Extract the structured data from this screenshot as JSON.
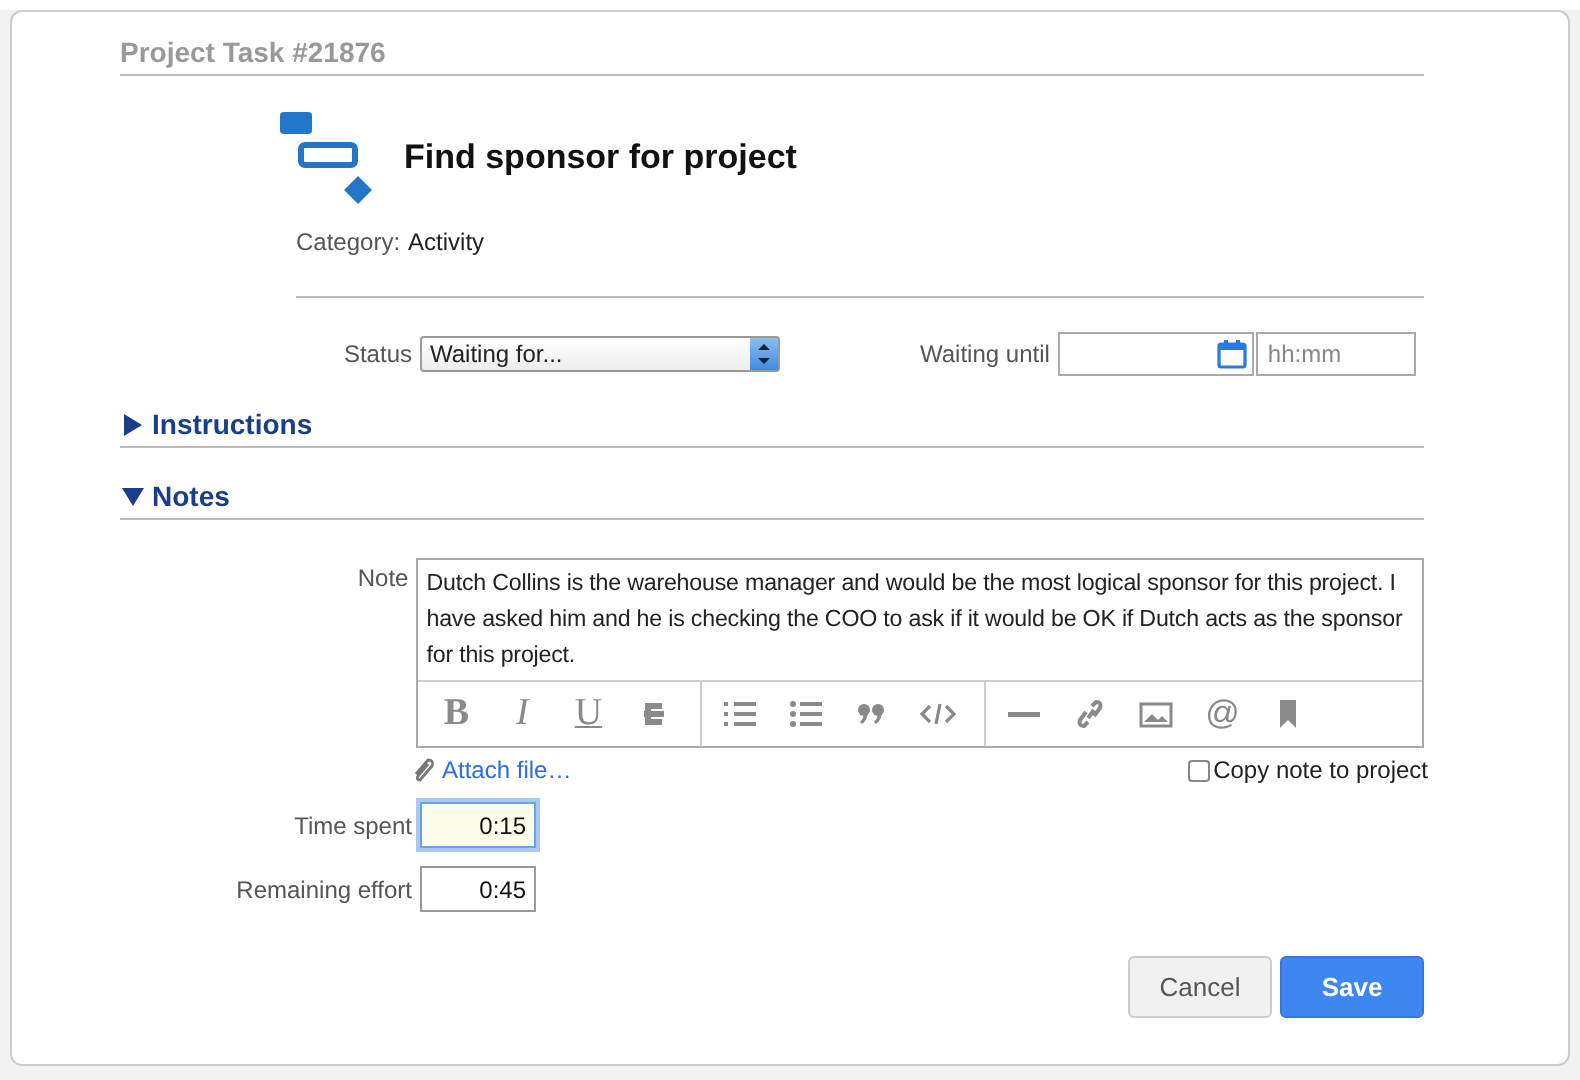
{
  "header": {
    "title": "Project Task #21876"
  },
  "task": {
    "name": "Find sponsor for project",
    "category_label": "Category:",
    "category": "Activity"
  },
  "status": {
    "label": "Status",
    "value": "Waiting for..."
  },
  "waiting_until": {
    "label": "Waiting until",
    "time_placeholder": "hh:mm"
  },
  "sections": [
    {
      "title": "Instructions",
      "expanded": false
    },
    {
      "title": "Notes",
      "expanded": true
    }
  ],
  "note": {
    "label": "Note",
    "value": "Dutch Collins is the warehouse manager and would be the most logical sponsor for this project. I have asked him and he is checking the COO to ask if it would be OK if Dutch acts as the sponsor for this project.",
    "toolbar": [
      [
        {
          "kind": "bold",
          "label": "B"
        },
        {
          "kind": "italic",
          "label": "I"
        },
        {
          "kind": "underline",
          "label": "U"
        },
        {
          "kind": "strike"
        }
      ],
      [
        {
          "kind": "ordered-list"
        },
        {
          "kind": "bullet-list"
        },
        {
          "kind": "quote"
        },
        {
          "kind": "code"
        }
      ],
      [
        {
          "kind": "rule"
        },
        {
          "kind": "link"
        },
        {
          "kind": "image"
        },
        {
          "kind": "mention",
          "label": "@"
        },
        {
          "kind": "bookmark"
        }
      ]
    ],
    "attach": "Attach file…",
    "copy_label": "Copy note to project",
    "copy_checked": false
  },
  "time_fields": [
    {
      "label": "Time spent",
      "value": "0:15",
      "focused": true
    },
    {
      "label": "Remaining effort",
      "value": "0:45",
      "focused": false
    }
  ],
  "buttons": [
    {
      "label": "Cancel",
      "kind": "secondary"
    },
    {
      "label": "Save",
      "kind": "primary"
    }
  ]
}
